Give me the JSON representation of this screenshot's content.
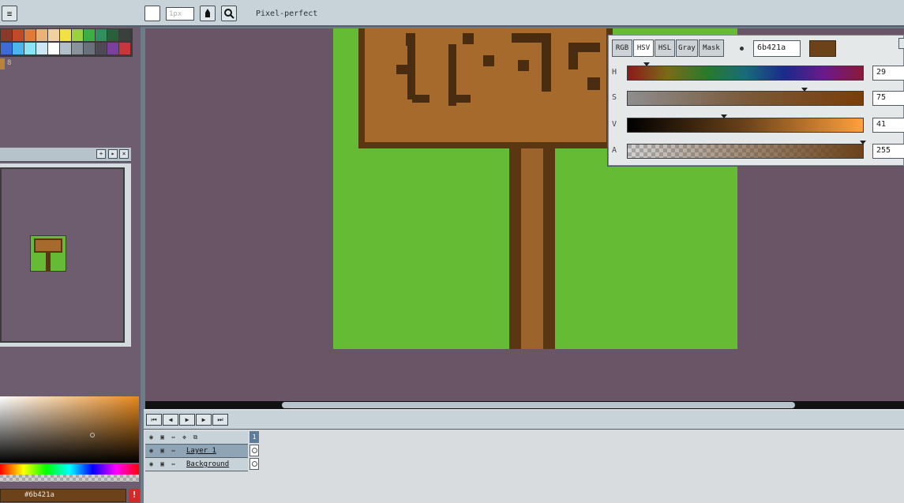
{
  "toolbar": {
    "brush_size": "1px",
    "mode_label": "Pixel-perfect",
    "icons": [
      "menu-icon",
      "pen-icon",
      "zoom-icon"
    ]
  },
  "palette": {
    "swatches": [
      "#8b3a2a",
      "#c24a2a",
      "#e07b35",
      "#e9b277",
      "#f2d1a1",
      "#f0e240",
      "#9ad13c",
      "#3cae43",
      "#2f8f5f",
      "#2b5e3b",
      "#38423a",
      "#3e6bd6",
      "#4cb6e8",
      "#8be3f3",
      "#cde7f5",
      "#ffffff",
      "#b3bfc8",
      "#8a939b",
      "#6a707a",
      "#4d4a55",
      "#7b3fa0",
      "#c8353a"
    ],
    "selected_index_label": "8"
  },
  "dialog": {
    "modes": [
      "RGB",
      "HSV",
      "HSL",
      "Gray",
      "Mask"
    ],
    "active_mode": "HSV",
    "hex_value": "6b421a",
    "color": "#6b421a",
    "channels": [
      {
        "label": "H",
        "value": "29",
        "level": 0.08
      },
      {
        "label": "S",
        "value": "75",
        "level": 0.75
      },
      {
        "label": "V",
        "value": "41",
        "level": 0.41
      },
      {
        "label": "A",
        "value": "255",
        "level": 1.0
      }
    ]
  },
  "color_bar": {
    "hex_label": "#6b421a",
    "warning_label": "!"
  },
  "timeline": {
    "nav_buttons": [
      "⏮",
      "◀",
      "▶",
      "▶",
      "⏭"
    ],
    "frame_number": "1",
    "layers": [
      {
        "name": "Layer 1",
        "selected": true
      },
      {
        "name": "Background",
        "selected": false
      }
    ]
  },
  "colors": {
    "canvas_bg": "#695565",
    "grass": "#66bb34",
    "wood": "#a66a2d",
    "wood_dark": "#5a3612",
    "ui_panel": "#c7d2d9"
  }
}
